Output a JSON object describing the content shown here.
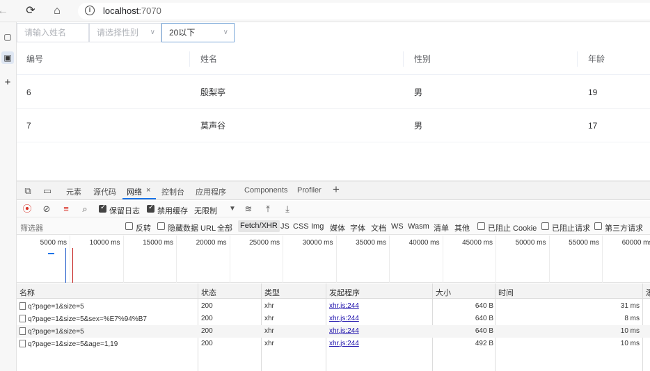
{
  "browser": {
    "url_host": "localhost",
    "url_port": ":7070"
  },
  "filters": {
    "name_placeholder": "请输入姓名",
    "gender_placeholder": "请选择性别",
    "age_value": "20以下"
  },
  "table": {
    "headers": [
      "编号",
      "姓名",
      "性别",
      "年龄"
    ],
    "rows": [
      {
        "id": "6",
        "name": "殷梨亭",
        "gender": "男",
        "age": "19"
      },
      {
        "id": "7",
        "name": "莫声谷",
        "gender": "男",
        "age": "17"
      }
    ]
  },
  "devtools": {
    "tabs": [
      "元素",
      "源代码",
      "网络",
      "控制台",
      "应用程序",
      "Components",
      "Profiler"
    ],
    "network_tab_close": "×",
    "toolbar": {
      "preserve_log": "保留日志",
      "disable_cache": "禁用缓存",
      "throttle": "无限制"
    },
    "filter": {
      "placeholder": "筛选器",
      "invert": "反转",
      "hide_data_urls": "隐藏数据 URL",
      "types": [
        "全部",
        "Fetch/XHR",
        "JS",
        "CSS",
        "Img",
        "媒体",
        "字体",
        "文档",
        "WS",
        "Wasm",
        "清单",
        "其他"
      ],
      "blocked_cookies": "已阻止 Cookie",
      "blocked_requests": "已阻止请求",
      "third_party": "第三方请求"
    },
    "timeline_ticks": [
      "5000 ms",
      "10000 ms",
      "15000 ms",
      "20000 ms",
      "25000 ms",
      "30000 ms",
      "35000 ms",
      "40000 ms",
      "45000 ms",
      "50000 ms",
      "55000 ms",
      "60000 ms"
    ],
    "requests": {
      "headers": [
        "名称",
        "状态",
        "类型",
        "发起程序",
        "大小",
        "时间",
        "瀑"
      ],
      "rows": [
        {
          "name": "q?page=1&size=5",
          "status": "200",
          "type": "xhr",
          "initiator": "xhr.js:244",
          "size": "640 B",
          "time": "31 ms"
        },
        {
          "name": "q?page=1&size=5&sex=%E7%94%B7",
          "status": "200",
          "type": "xhr",
          "initiator": "xhr.js:244",
          "size": "640 B",
          "time": "8 ms"
        },
        {
          "name": "q?page=1&size=5",
          "status": "200",
          "type": "xhr",
          "initiator": "xhr.js:244",
          "size": "640 B",
          "time": "10 ms"
        },
        {
          "name": "q?page=1&size=5&age=1,19",
          "status": "200",
          "type": "xhr",
          "initiator": "xhr.js:244",
          "size": "492 B",
          "time": "10 ms"
        }
      ]
    }
  }
}
